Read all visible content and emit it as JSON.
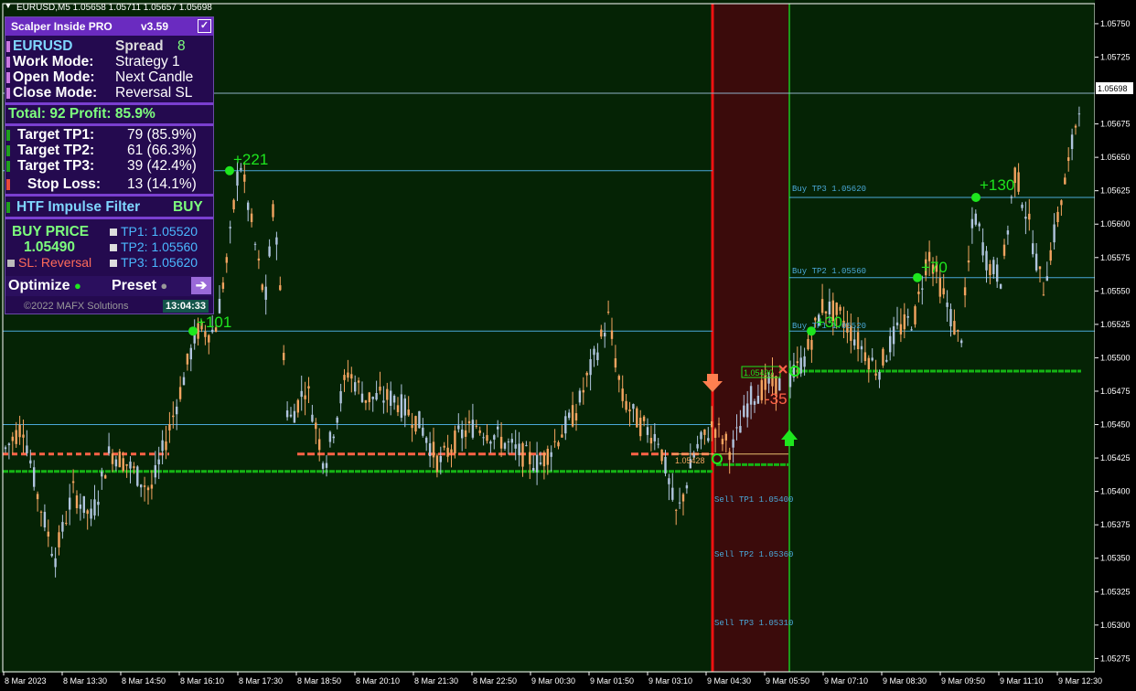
{
  "header": {
    "symbol_info": "EURUSD,M5  1.05658 1.05711 1.05657 1.05698"
  },
  "panel": {
    "title": "Scalper Inside PRO",
    "version": "v3.59",
    "symbol": "EURUSD",
    "spread_label": "Spread",
    "spread_value": "8",
    "work_mode_label": "Work  Mode:",
    "work_mode_value": "Strategy 1",
    "open_mode_label": "Open  Mode:",
    "open_mode_value": "Next Candle",
    "close_mode_label": "Close Mode:",
    "close_mode_value": "Reversal SL",
    "total_text": "Total: 92  Profit: 85.9%",
    "tp1_label": "Target TP1:",
    "tp1_value": "79 (85.9%)",
    "tp2_label": "Target TP2:",
    "tp2_value": "61 (66.3%)",
    "tp3_label": "Target TP3:",
    "tp3_value": "39 (42.4%)",
    "sl_label": "Stop Loss:",
    "sl_value": "13 (14.1%)",
    "htf_label": "HTF Impulse Filter",
    "htf_value": "BUY",
    "buy_price_label": "BUY PRICE",
    "buy_price_value": "1.05490",
    "sl_text": "SL: Reversal",
    "tp1_text": "TP1: 1.05520",
    "tp2_text": "TP2: 1.05560",
    "tp3_text": "TP3: 1.05620",
    "optimize_label": "Optimize",
    "preset_label": "Preset",
    "copyright": "©2022 MAFX Solutions",
    "clock": "13:04:33"
  },
  "axis": {
    "price_ticks": [
      "1.05750",
      "1.05725",
      "1.05675",
      "1.05650",
      "1.05625",
      "1.05600",
      "1.05575",
      "1.05550",
      "1.05525",
      "1.05500",
      "1.05475",
      "1.05450",
      "1.05425",
      "1.05400",
      "1.05375",
      "1.05350",
      "1.05325",
      "1.05300",
      "1.05275"
    ],
    "current_price": "1.05698",
    "time_ticks": [
      "8 Mar 2023",
      "8 Mar 13:30",
      "8 Mar 14:50",
      "8 Mar 16:10",
      "8 Mar 17:30",
      "8 Mar 18:50",
      "8 Mar 20:10",
      "8 Mar 21:30",
      "8 Mar 22:50",
      "9 Mar 00:30",
      "9 Mar 01:50",
      "9 Mar 03:10",
      "9 Mar 04:30",
      "9 Mar 05:50",
      "9 Mar 07:10",
      "9 Mar 08:30",
      "9 Mar 09:50",
      "9 Mar 11:10",
      "9 Mar 12:30"
    ]
  },
  "annotations": {
    "buy_tp3": "Buy TP3 1.05620",
    "buy_tp2": "Buy TP2 1.05560",
    "buy_tp1": "Buy TP1 1.05520",
    "sell_tp1": "Sell TP1 1.05400",
    "sell_tp2": "Sell TP2 1.05360",
    "sell_tp3": "Sell TP3 1.05310",
    "profit_221": "+221",
    "profit_101": "+101",
    "profit_130": "+130",
    "profit_70": "+70",
    "profit_30": "+30",
    "loss_35": "-35",
    "entry_box": "1.05490",
    "sell_entry": "1.05428"
  },
  "colors": {
    "background": "#052305",
    "bull_candle": "#b0c4de",
    "bear_candle": "#f4a460",
    "buy_line": "#14b414",
    "sell_line": "#ff6347",
    "tp_line": "#4aa8d8",
    "sell_zone": "#3b0b0b"
  },
  "chart_data": {
    "type": "candlestick",
    "symbol": "EURUSD",
    "timeframe": "M5",
    "last_ohlc": {
      "open": 1.05658,
      "high": 1.05711,
      "low": 1.05657,
      "close": 1.05698
    },
    "ylim": [
      1.05265,
      1.05765
    ],
    "levels": {
      "buy_tp3": 1.0562,
      "buy_tp2": 1.0556,
      "buy_tp1": 1.0552,
      "sell_tp1": 1.054,
      "sell_tp2": 1.0536,
      "sell_tp3": 1.0531,
      "buy_entry": 1.0549,
      "sell_entry": 1.05428
    }
  }
}
